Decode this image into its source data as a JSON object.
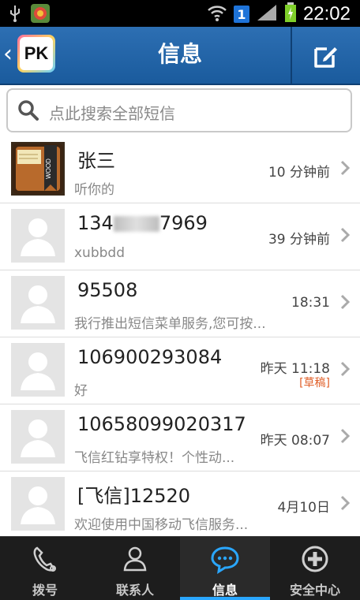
{
  "status_bar": {
    "time": "22:02",
    "sim_slot": "1"
  },
  "header": {
    "back_symbol": "‹",
    "logo_text": "PK",
    "title": "信息"
  },
  "search": {
    "placeholder": "点此搜索全部短信"
  },
  "messages": [
    {
      "name": "张三",
      "preview": "听你的",
      "time": "10 分钟前",
      "avatar": "wood-notebook"
    },
    {
      "name_prefix": "134",
      "name_suffix": "7969",
      "preview": "xubbdd",
      "time": "39 分钟前",
      "avatar": "default"
    },
    {
      "name": "95508",
      "preview": "我行推出短信菜单服务,您可按...",
      "time": "18:31",
      "avatar": "default"
    },
    {
      "name": "106900293084",
      "preview": "好",
      "time": "昨天 11:18",
      "draft": "[草稿]",
      "avatar": "default"
    },
    {
      "name": "10658099020317",
      "preview": "飞信红钻享特权！个性动...",
      "time": "昨天 08:07",
      "avatar": "default"
    },
    {
      "name": "[飞信]12520",
      "preview": "欢迎使用中国移动飞信服务...",
      "time": "4月10日",
      "avatar": "default"
    }
  ],
  "tabs": [
    {
      "label": "拨号",
      "icon": "phone-icon",
      "active": false
    },
    {
      "label": "联系人",
      "icon": "contact-icon",
      "active": false
    },
    {
      "label": "信息",
      "icon": "message-icon",
      "active": true
    },
    {
      "label": "安全中心",
      "icon": "shield-plus-icon",
      "active": false
    }
  ],
  "colors": {
    "header": "#2d6fb3",
    "active_tab": "#2aa7ff",
    "draft": "#e0602a"
  }
}
